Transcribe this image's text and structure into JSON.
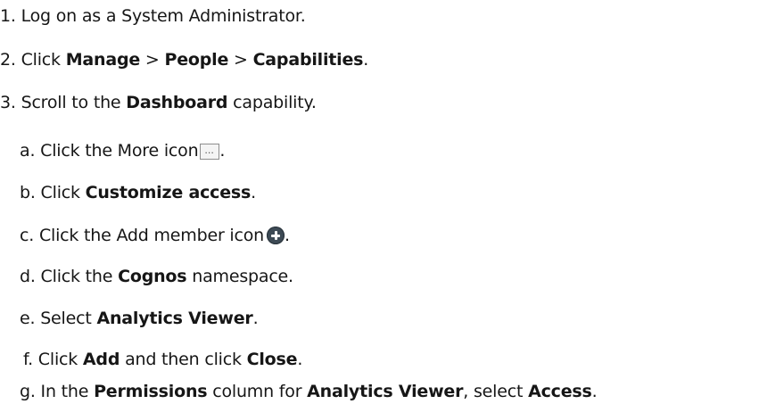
{
  "steps": [
    {
      "number": "1.",
      "parts": [
        "Log on as a System Administrator."
      ]
    },
    {
      "number": "2.",
      "pre": "Click ",
      "b1": "Manage",
      "sep1": " > ",
      "b2": "People",
      "sep2": " > ",
      "b3": "Capabilities",
      "post": "."
    },
    {
      "number": "3.",
      "pre": "Scroll to the ",
      "b1": "Dashboard",
      "post": " capability."
    }
  ],
  "substeps": {
    "a": {
      "letter": "a.",
      "pre": "Click the More icon",
      "post": ".",
      "icon": "more-icon"
    },
    "b": {
      "letter": "b.",
      "pre": "Click ",
      "b1": "Customize access",
      "post": "."
    },
    "c": {
      "letter": "c.",
      "pre": "Click the Add member icon",
      "post": ".",
      "icon": "add-member-icon"
    },
    "d": {
      "letter": "d.",
      "pre": "Click the ",
      "b1": "Cognos",
      "post": " namespace."
    },
    "e": {
      "letter": "e.",
      "pre": "Select ",
      "b1": "Analytics Viewer",
      "post": "."
    },
    "f": {
      "letter": "f.",
      "pre": "Click ",
      "b1": "Add",
      "mid": " and then click ",
      "b2": "Close",
      "post": "."
    },
    "g": {
      "letter": "g.",
      "pre": "In the ",
      "b1": "Permissions",
      "mid": " column for ",
      "b2": "Analytics Viewer",
      "mid2": ", select ",
      "b3": "Access",
      "post": "."
    }
  }
}
